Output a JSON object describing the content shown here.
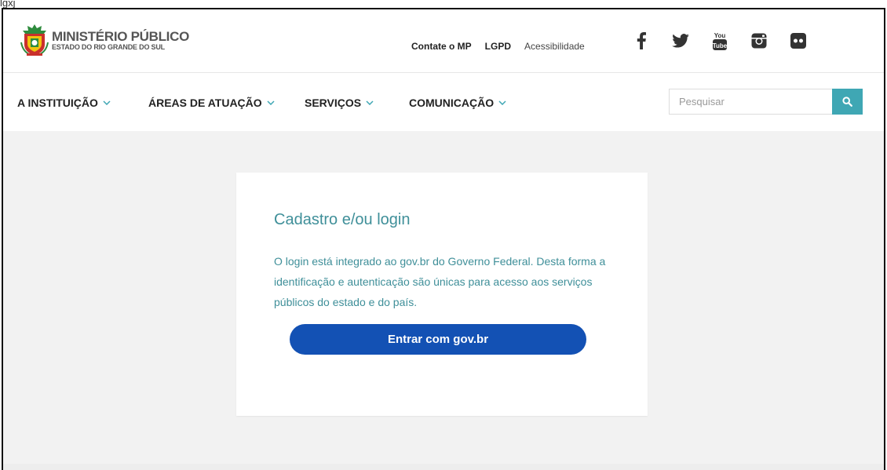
{
  "page_top_cutoff": "lgxj",
  "logo": {
    "title": "MINISTÉRIO PÚBLICO",
    "subtitle": "ESTADO DO RIO GRANDE DO SUL"
  },
  "top_links": {
    "contact": "Contate o MP",
    "lgpd": "LGPD",
    "accessibility": "Acessibilidade"
  },
  "social": [
    {
      "icon": "facebook-icon"
    },
    {
      "icon": "twitter-icon"
    },
    {
      "icon": "youtube-icon",
      "label_top": "You",
      "label_bottom": "Tube"
    },
    {
      "icon": "instagram-icon"
    },
    {
      "icon": "flickr-icon"
    }
  ],
  "nav": {
    "items": [
      {
        "label": "A INSTITUIÇÃO"
      },
      {
        "label": "ÁREAS DE ATUAÇÃO"
      },
      {
        "label": "SERVIÇOS"
      },
      {
        "label": "COMUNICAÇÃO"
      }
    ]
  },
  "search": {
    "placeholder": "Pesquisar",
    "value": ""
  },
  "card": {
    "title": "Cadastro e/ou login",
    "text": "O login está integrado ao gov.br do Governo Federal. Desta forma a identificação e autenticação são únicas para acesso aos serviços públicos do estado e do país.",
    "button_label": "Entrar com gov.br"
  },
  "colors": {
    "accent": "#3fa7b4",
    "card_text": "#3f8f99",
    "govbr_button": "#1351b4",
    "background": "#f2f2f2"
  }
}
